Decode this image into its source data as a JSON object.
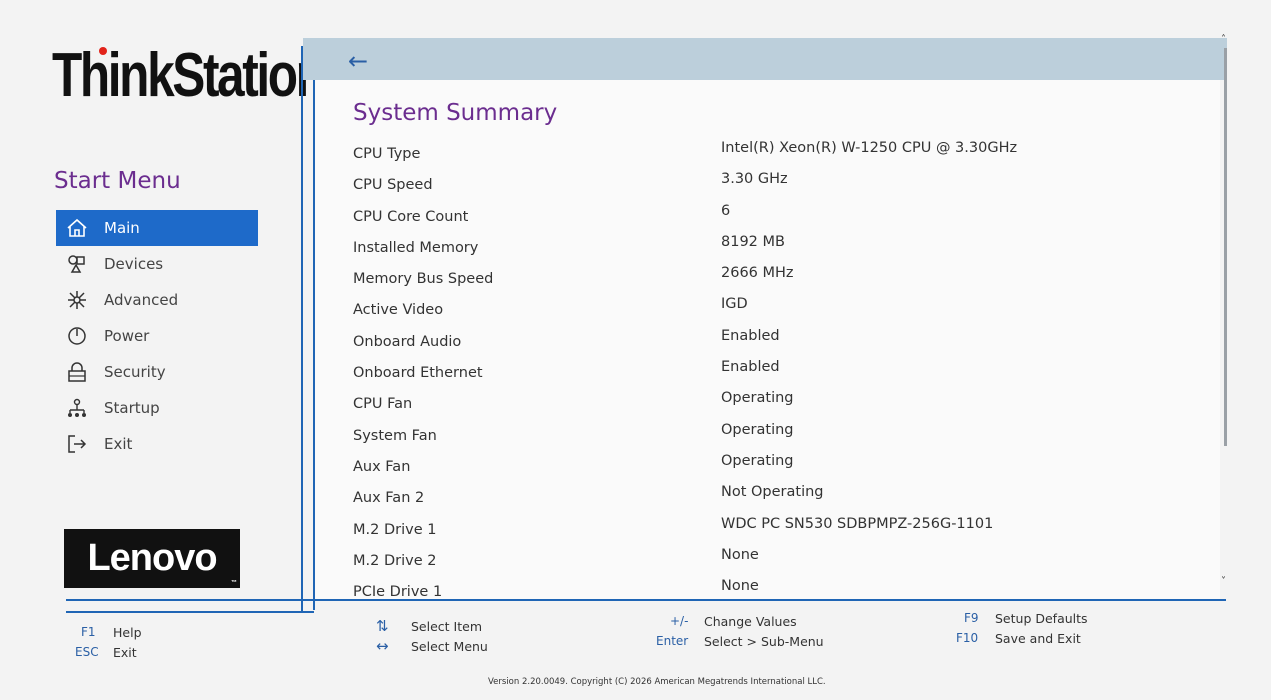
{
  "brand": "ThinkStation",
  "lenovo_logo": "Lenovo",
  "sidebar": {
    "title": "Start Menu",
    "items": [
      {
        "label": "Main",
        "icon": "home-icon"
      },
      {
        "label": "Devices",
        "icon": "devices-icon"
      },
      {
        "label": "Advanced",
        "icon": "advanced-icon"
      },
      {
        "label": "Power",
        "icon": "power-icon"
      },
      {
        "label": "Security",
        "icon": "lock-icon"
      },
      {
        "label": "Startup",
        "icon": "startup-icon"
      },
      {
        "label": "Exit",
        "icon": "exit-icon"
      }
    ]
  },
  "header": {
    "back_icon": "arrow-left-icon"
  },
  "main": {
    "title": "System Summary",
    "rows": [
      {
        "label": "CPU Type",
        "value": "Intel(R) Xeon(R) W-1250 CPU @ 3.30GHz"
      },
      {
        "label": "CPU Speed",
        "value": "3.30 GHz"
      },
      {
        "label": "CPU Core Count",
        "value": "6"
      },
      {
        "label": "Installed Memory",
        "value": "8192 MB"
      },
      {
        "label": "Memory Bus Speed",
        "value": "2666 MHz"
      },
      {
        "label": "Active Video",
        "value": "IGD"
      },
      {
        "label": "Onboard Audio",
        "value": "Enabled"
      },
      {
        "label": "Onboard Ethernet",
        "value": "Enabled"
      },
      {
        "label": "CPU Fan",
        "value": "Operating"
      },
      {
        "label": "System Fan",
        "value": "Operating"
      },
      {
        "label": "Aux Fan",
        "value": "Operating"
      },
      {
        "label": "Aux Fan 2",
        "value": "Not Operating"
      },
      {
        "label": "M.2 Drive 1",
        "value": "WDC PC SN530 SDBPMPZ-256G-1101"
      },
      {
        "label": "M.2 Drive 2",
        "value": "None"
      },
      {
        "label": "PCIe Drive 1",
        "value": "None"
      }
    ]
  },
  "footer": {
    "f1_key": "F1",
    "f1_desc": "Help",
    "esc_key": "ESC",
    "esc_desc": "Exit",
    "updown_desc": "Select Item",
    "leftright_desc": "Select Menu",
    "plusminus_key": "+/-",
    "plusminus_desc": "Change Values",
    "enter_key": "Enter",
    "enter_desc": "Select > Sub-Menu",
    "f9_key": "F9",
    "f9_desc": "Setup Defaults",
    "f10_key": "F10",
    "f10_desc": "Save and Exit",
    "version": "Version 2.20.0049. Copyright (C) 2026 American Megatrends International LLC."
  },
  "colors": {
    "accent": "#1e6ac9",
    "title": "#6b2d8f",
    "header": "#bccfdb"
  }
}
